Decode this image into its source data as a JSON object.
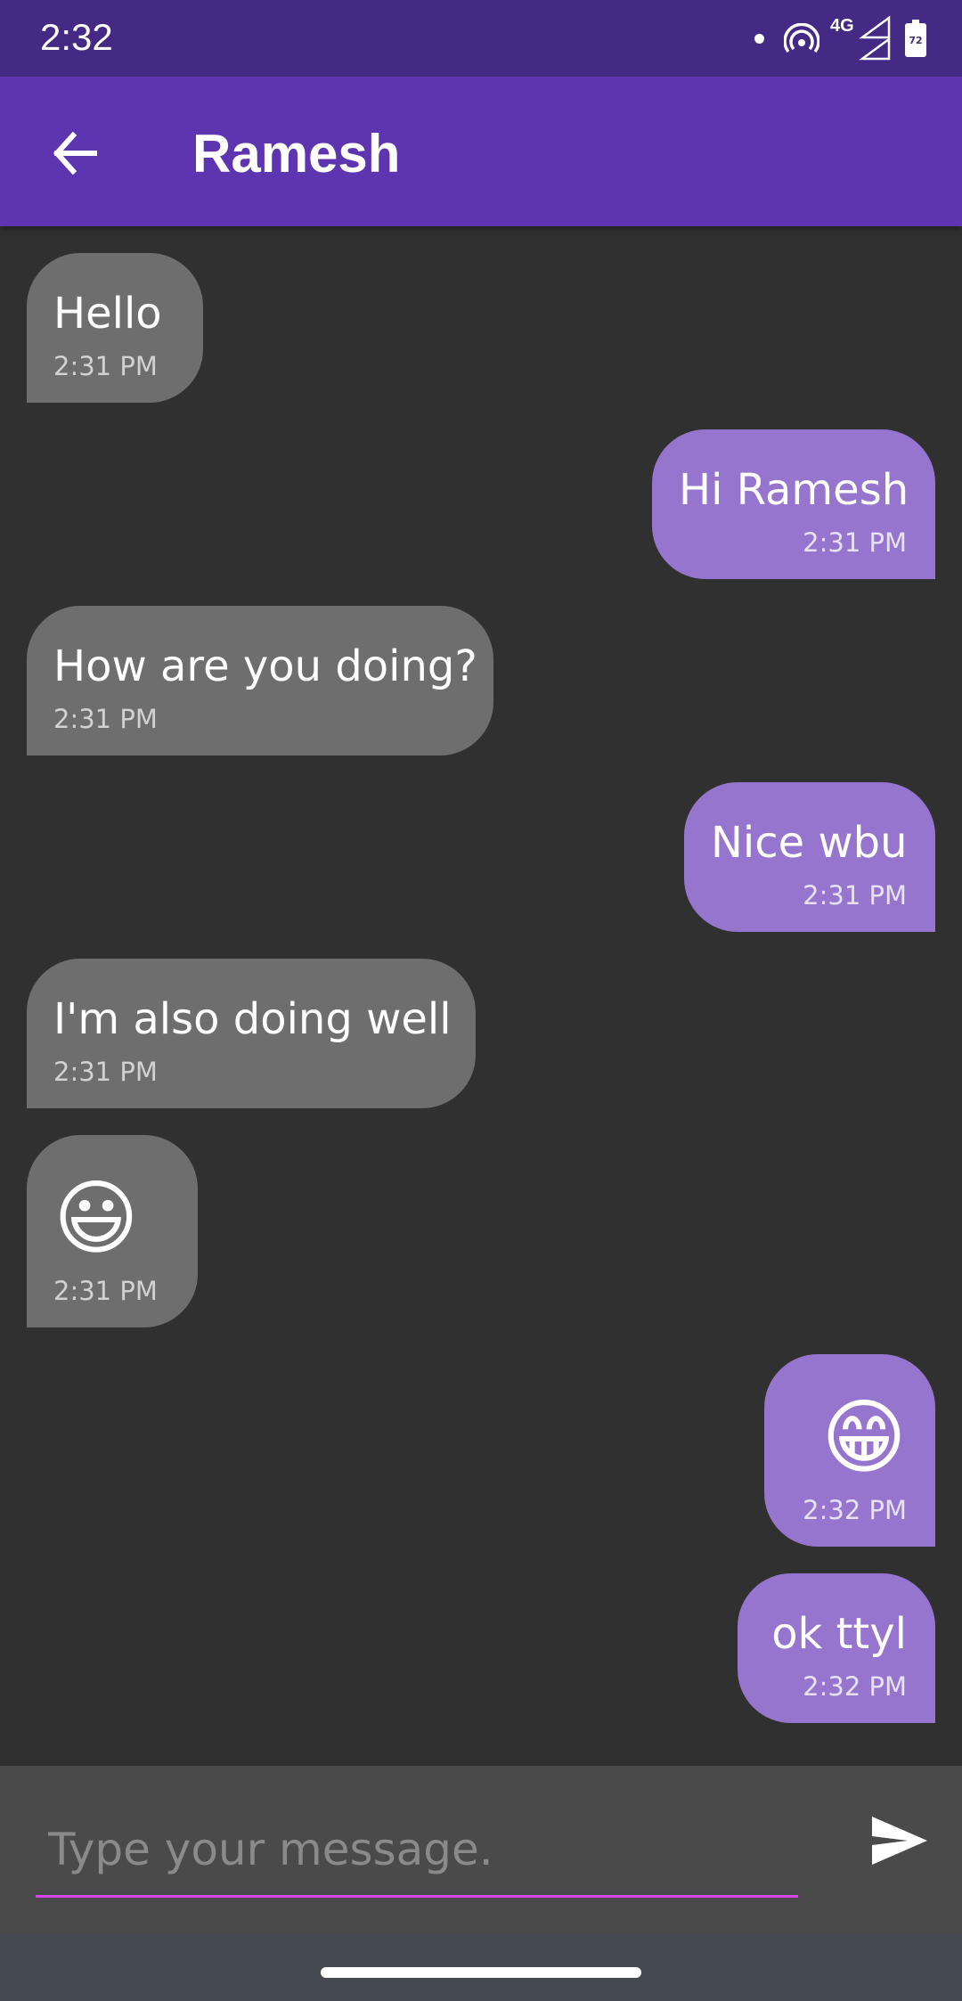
{
  "status_bar": {
    "time": "2:32",
    "network": "4G",
    "battery": "72"
  },
  "app_bar": {
    "title": "Ramesh",
    "back_icon": "arrow-left-icon"
  },
  "messages": [
    {
      "direction": "incoming",
      "text": "Hello",
      "time": "2:31 PM"
    },
    {
      "direction": "outgoing",
      "text": "Hi Ramesh",
      "time": "2:31 PM"
    },
    {
      "direction": "incoming",
      "text": "How are you doing?",
      "time": "2:31 PM"
    },
    {
      "direction": "outgoing",
      "text": "Nice wbu",
      "time": "2:31 PM"
    },
    {
      "direction": "incoming",
      "text": "I'm also doing well",
      "time": "2:31 PM"
    },
    {
      "direction": "incoming",
      "text": "😃",
      "time": "2:31 PM"
    },
    {
      "direction": "outgoing",
      "text": "😁",
      "time": "2:32 PM"
    },
    {
      "direction": "outgoing",
      "text": "ok ttyl",
      "time": "2:32 PM"
    }
  ],
  "composer": {
    "placeholder": "Type your message.",
    "value": "",
    "send_icon": "send-icon"
  },
  "colors": {
    "status_bar": "#442a84",
    "app_bar": "#5e35b1",
    "background": "#303030",
    "incoming_bubble": "#6e6e6e",
    "outgoing_bubble": "#9575cd",
    "input_underline": "#d445f0"
  }
}
